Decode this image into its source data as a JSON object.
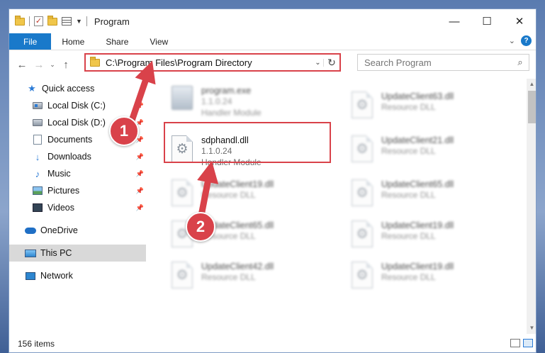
{
  "window": {
    "title": "Program"
  },
  "ribbon": {
    "tabs": [
      {
        "label": "File"
      },
      {
        "label": "Home"
      },
      {
        "label": "Share"
      },
      {
        "label": "View"
      }
    ]
  },
  "address": {
    "path": "C:\\Program Files\\Program Directory"
  },
  "search": {
    "placeholder": "Search Program"
  },
  "sidebar": {
    "items": [
      {
        "label": "Quick access"
      },
      {
        "label": "Local Disk (C:)"
      },
      {
        "label": "Local Disk (D:)"
      },
      {
        "label": "Documents"
      },
      {
        "label": "Downloads"
      },
      {
        "label": "Music"
      },
      {
        "label": "Pictures"
      },
      {
        "label": "Videos"
      },
      {
        "label": "OneDrive"
      },
      {
        "label": "This PC"
      },
      {
        "label": "Network"
      }
    ]
  },
  "files": {
    "left": [
      {
        "name": "program.exe",
        "version": "1.1.0.24",
        "type": "Handler Module"
      },
      {
        "name": "sdphandl.dll",
        "version": "1.1.0.24",
        "type": "Handler Module"
      },
      {
        "name": "UpdateClient19.dll",
        "version": "",
        "type": "Resource DLL"
      },
      {
        "name": "UpdateClient65.dll",
        "version": "",
        "type": "Resource DLL"
      },
      {
        "name": "UpdateClient42.dll",
        "version": "",
        "type": "Resource DLL"
      }
    ],
    "right": [
      {
        "name": "UpdateClient63.dll",
        "type": "Resource DLL"
      },
      {
        "name": "UpdateClient21.dll",
        "type": "Resource DLL"
      },
      {
        "name": "UpdateClient65.dll",
        "type": "Resource DLL"
      },
      {
        "name": "UpdateClient19.dll",
        "type": "Resource DLL"
      },
      {
        "name": "UpdateClient19.dll",
        "type": "Resource DLL"
      }
    ]
  },
  "status": {
    "item_count": "156 items"
  },
  "annotations": {
    "step1": "1",
    "step2": "2"
  },
  "colors": {
    "accent": "#1979ca",
    "highlight": "#d9424a",
    "selected": "#d9d9d9"
  }
}
